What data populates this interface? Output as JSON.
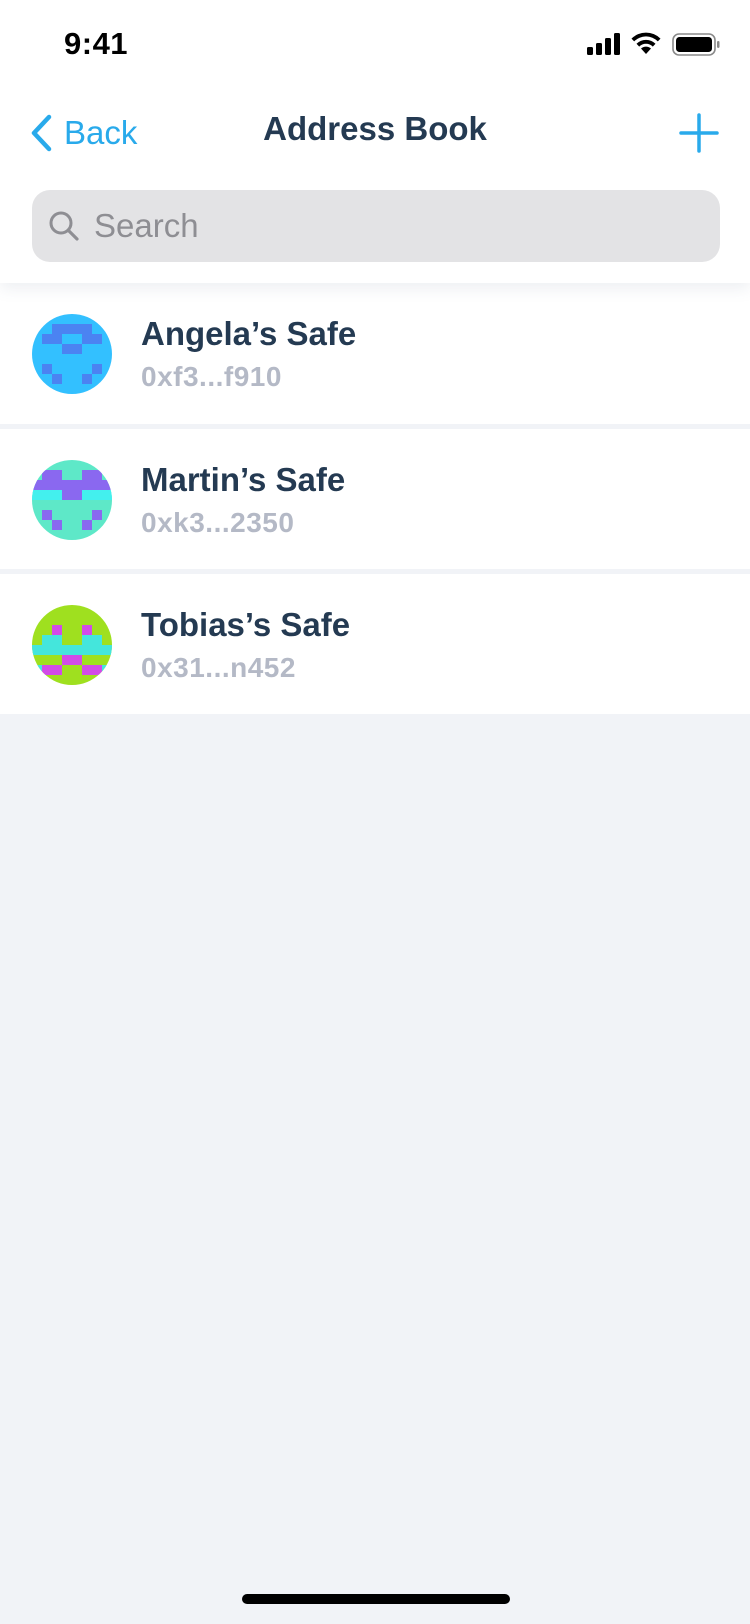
{
  "status_bar": {
    "time": "9:41",
    "signal_icon": "cellular-signal-icon",
    "wifi_icon": "wifi-icon",
    "battery_icon": "battery-icon"
  },
  "nav": {
    "back_label": "Back",
    "title": "Address Book",
    "add_icon": "plus-icon"
  },
  "search": {
    "placeholder": "Search",
    "value": ""
  },
  "contacts": [
    {
      "name": "Angela’s Safe",
      "address": "0xf3...f910",
      "avatar_colors": {
        "bg": "#33c0ff",
        "fg": "#4b83f2",
        "accent": "#33c0ff"
      }
    },
    {
      "name": "Martin’s Safe",
      "address": "0xk3...2350",
      "avatar_colors": {
        "bg": "#5ee8c8",
        "fg": "#8a68f0",
        "accent": "#43f0ee"
      }
    },
    {
      "name": "Tobias’s Safe",
      "address": "0x31...n452",
      "avatar_colors": {
        "bg": "#9fe01f",
        "fg": "#d24be8",
        "accent": "#44e6dc"
      }
    }
  ],
  "colors": {
    "accent": "#29aaeb",
    "title_text": "#243a52",
    "secondary_text": "#b4b9c6",
    "background": "#f1f3f7"
  }
}
